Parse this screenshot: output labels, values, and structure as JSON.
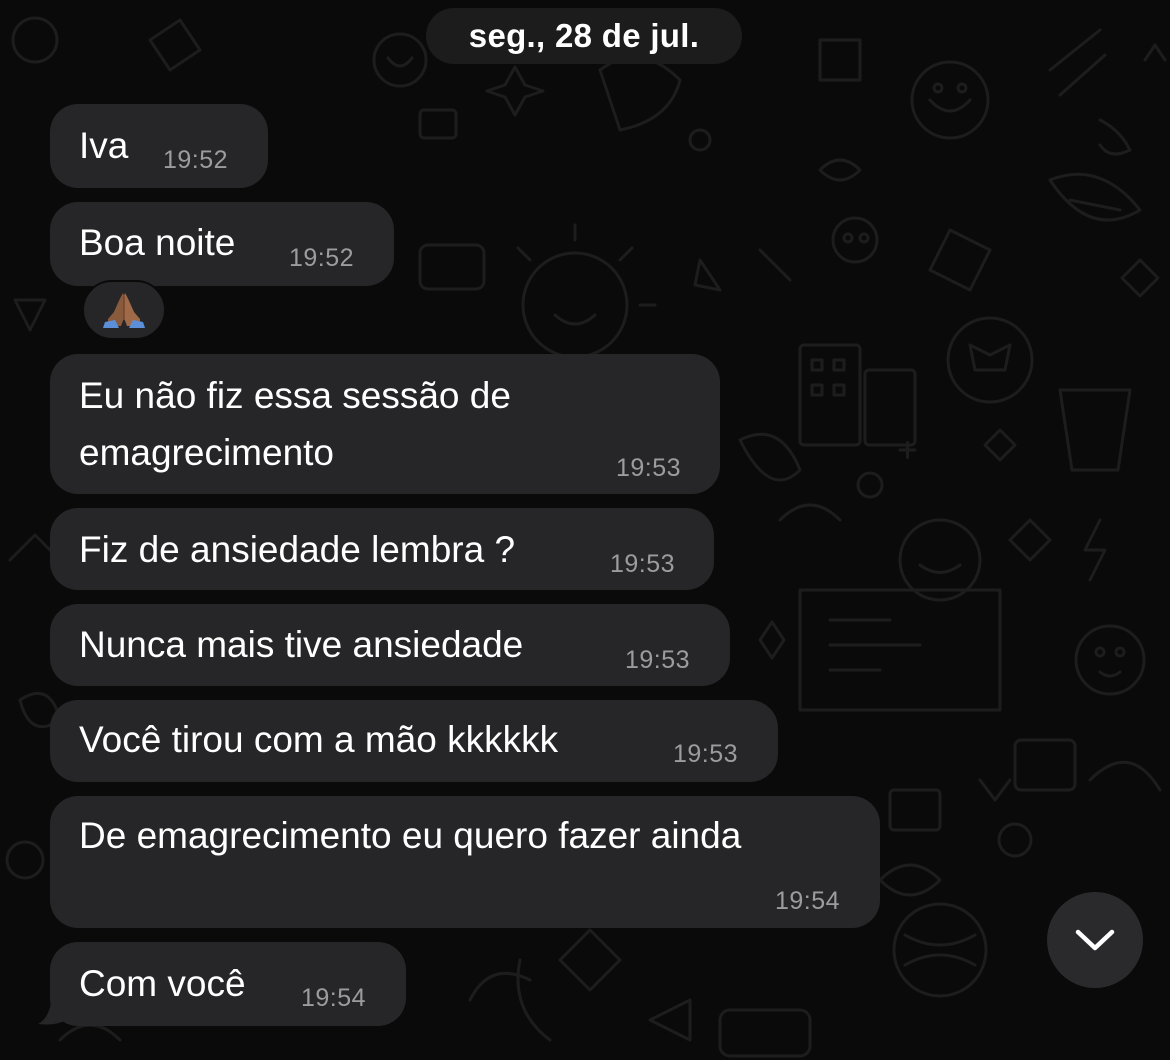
{
  "chat": {
    "date_separator": "seg., 28 de jul.",
    "messages": [
      {
        "text": "Iva",
        "time": "19:52"
      },
      {
        "text": "Boa noite",
        "time": "19:52"
      },
      {
        "text_line1": "Eu não fiz essa sessão de",
        "text_line2": "emagrecimento",
        "time": "19:53"
      },
      {
        "text": "Fiz de ansiedade lembra ?",
        "time": "19:53"
      },
      {
        "text": "Nunca mais tive ansiedade",
        "time": "19:53"
      },
      {
        "text": "Você tirou com a mão kkkkkk",
        "time": "19:53"
      },
      {
        "text": "De emagrecimento eu quero fazer ainda",
        "time": "19:54"
      },
      {
        "text": "Com você",
        "time": "19:54"
      }
    ],
    "reaction": {
      "icon": "folded-hands-emoji"
    },
    "scroll_button": {
      "icon": "chevron-down-icon"
    }
  },
  "colors": {
    "background": "#0a0a0a",
    "bubble": "#262628",
    "text": "#ffffff",
    "timestamp": "#9c9c9f"
  }
}
